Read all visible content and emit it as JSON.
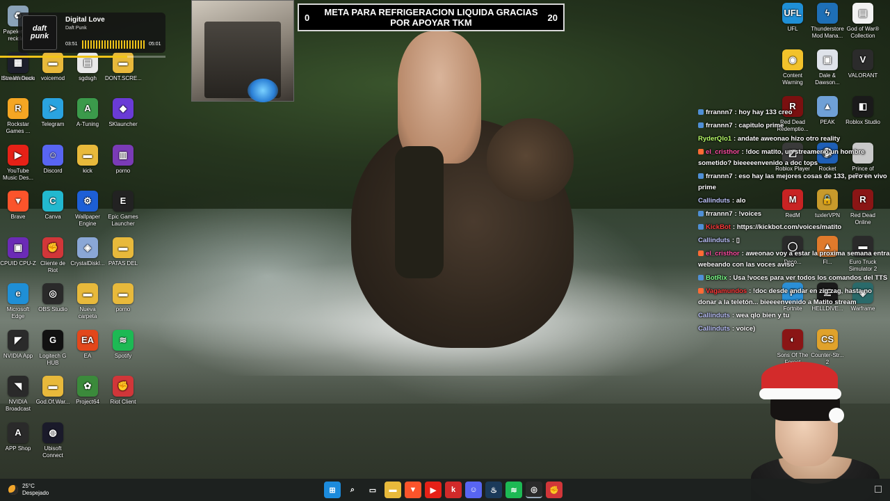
{
  "stream_goal": {
    "left_value": "0",
    "text": "META PARA REFRIGERACION LIQUIDA GRACIAS POR APOYAR TKM",
    "right_value": "20"
  },
  "music_widget": {
    "album_text": "daft punk",
    "title": "Digital Love",
    "artist": "Daft Punk",
    "elapsed": "03:51",
    "duration": "05:01",
    "progress": 0.77
  },
  "desktop_left": [
    {
      "name": "papelera",
      "label": "Papelera de reciclaje",
      "icon": "recycle-bin-icon",
      "color": "#8aa2b8",
      "glyph": "♻"
    },
    {
      "name": "iriun-webcam",
      "label": "Iriun Webcam",
      "icon": "webcam-icon",
      "color": "#2b6fd6",
      "glyph": "◉"
    },
    {
      "name": "stream-deck",
      "label": "Stream Deck",
      "icon": "stream-deck-icon",
      "color": "#1d1f2b",
      "glyph": "▦"
    },
    {
      "name": "voicemod",
      "label": "voicemod",
      "icon": "folder-icon",
      "color": "#e8b93b",
      "glyph": "▬"
    },
    {
      "name": "sgdsgh",
      "label": "sgdsgh",
      "icon": "document-icon",
      "color": "#e9e9e9",
      "glyph": "▤"
    },
    {
      "name": "dontscre",
      "label": "DONT.SCRE...",
      "icon": "folder-icon",
      "color": "#e8b93b",
      "glyph": "▬"
    },
    {
      "name": "rockstar",
      "label": "Rockstar Games ...",
      "icon": "rockstar-icon",
      "color": "#f5a623",
      "glyph": "R"
    },
    {
      "name": "telegram",
      "label": "Telegram",
      "icon": "telegram-icon",
      "color": "#2aa3e0",
      "glyph": "➤"
    },
    {
      "name": "a-tuning",
      "label": "A-Tuning",
      "icon": "a-tuning-icon",
      "color": "#3b9a4b",
      "glyph": "A"
    },
    {
      "name": "sklauncher",
      "label": "SKlauncher",
      "icon": "sklauncher-icon",
      "color": "#6a3bd6",
      "glyph": "◆"
    },
    {
      "name": "youtube-music",
      "label": "YouTube Music Des...",
      "icon": "youtube-music-icon",
      "color": "#e62117",
      "glyph": "▶"
    },
    {
      "name": "discord",
      "label": "Discord",
      "icon": "discord-icon",
      "color": "#5865f2",
      "glyph": "☺"
    },
    {
      "name": "kick",
      "label": "kick",
      "icon": "folder-icon",
      "color": "#e8b93b",
      "glyph": "▬"
    },
    {
      "name": "porno",
      "label": "porno",
      "icon": "winrar-icon",
      "color": "#7a3bb6",
      "glyph": "▥"
    },
    {
      "name": "brave",
      "label": "Brave",
      "icon": "brave-icon",
      "color": "#fb542b",
      "glyph": "▼"
    },
    {
      "name": "canva",
      "label": "Canva",
      "icon": "canva-icon",
      "color": "#22b8cf",
      "glyph": "C"
    },
    {
      "name": "wallpaper-engine",
      "label": "Wallpaper Engine",
      "icon": "wallpaper-engine-icon",
      "color": "#1d5fd6",
      "glyph": "⚙"
    },
    {
      "name": "epic-games",
      "label": "Epic Games Launcher",
      "icon": "epic-games-icon",
      "color": "#222222",
      "glyph": "E"
    },
    {
      "name": "cpuid",
      "label": "CPUID CPU-Z",
      "icon": "cpuz-icon",
      "color": "#6b2bb6",
      "glyph": "▣"
    },
    {
      "name": "riot-client",
      "label": "Cliente de Riot",
      "icon": "riot-icon",
      "color": "#d13639",
      "glyph": "✊"
    },
    {
      "name": "crystaldisk",
      "label": "CrystalDiskI...",
      "icon": "crystaldisk-icon",
      "color": "#8aa7d6",
      "glyph": "◈"
    },
    {
      "name": "patas-del",
      "label": "PATAS DEL",
      "icon": "folder-icon",
      "color": "#e8b93b",
      "glyph": "▬"
    },
    {
      "name": "edge",
      "label": "Microsoft Edge",
      "icon": "edge-icon",
      "color": "#1f8fd6",
      "glyph": "e"
    },
    {
      "name": "obs",
      "label": "OBS Studio",
      "icon": "obs-icon",
      "color": "#2a2a2a",
      "glyph": "◎"
    },
    {
      "name": "nueva-carpeta",
      "label": "Nueva carpeta",
      "icon": "folder-icon",
      "color": "#e8b93b",
      "glyph": "▬"
    },
    {
      "name": "porno-2",
      "label": "porno",
      "icon": "folder-icon",
      "color": "#e8b93b",
      "glyph": "▬"
    },
    {
      "name": "nvidia-app",
      "label": "NVIDIA App",
      "icon": "nvidia-icon",
      "color": "#2a2a2a",
      "glyph": "◤"
    },
    {
      "name": "logitech",
      "label": "Logitech G HUB",
      "icon": "logitech-icon",
      "color": "#111111",
      "glyph": "G"
    },
    {
      "name": "ea",
      "label": "EA",
      "icon": "ea-icon",
      "color": "#e3471b",
      "glyph": "EA"
    },
    {
      "name": "spotify",
      "label": "Spotify",
      "icon": "spotify-icon",
      "color": "#1db954",
      "glyph": "≋"
    },
    {
      "name": "nvidia-broadcast",
      "label": "NVIDIA Broadcast",
      "icon": "nvidia-broadcast-icon",
      "color": "#2a2a2a",
      "glyph": "◥"
    },
    {
      "name": "god-of-war-folder",
      "label": "God.Of.War...",
      "icon": "folder-icon",
      "color": "#e8b93b",
      "glyph": "▬"
    },
    {
      "name": "project64",
      "label": "Project64",
      "icon": "project64-icon",
      "color": "#3b8a3b",
      "glyph": "✿"
    },
    {
      "name": "riot-client-2",
      "label": "Riot Client",
      "icon": "riot-icon",
      "color": "#d13639",
      "glyph": "✊"
    },
    {
      "name": "app-shop",
      "label": "APP Shop",
      "icon": "app-shop-icon",
      "color": "#2a2a2a",
      "glyph": "A"
    },
    {
      "name": "ubisoft",
      "label": "Ubisoft Connect",
      "icon": "ubisoft-icon",
      "color": "#1a1a2a",
      "glyph": "◍"
    }
  ],
  "desktop_right": [
    {
      "name": "ufl",
      "label": "UFL",
      "icon": "ufl-icon",
      "color": "#1f8fd6",
      "glyph": "UFL"
    },
    {
      "name": "thunderstore",
      "label": "Thunderstore Mod Mana...",
      "icon": "thunderstore-icon",
      "color": "#1e6fb6",
      "glyph": "ϟ"
    },
    {
      "name": "gow-collection",
      "label": "God of War® Collection",
      "icon": "document-icon",
      "color": "#f2f2f2",
      "glyph": "▤"
    },
    {
      "name": "content-warning",
      "label": "Content Warning",
      "icon": "content-warning-icon",
      "color": "#f2c22b",
      "glyph": "◉"
    },
    {
      "name": "dale-dawson",
      "label": "Dale & Dawson...",
      "icon": "printer-icon",
      "color": "#dfe3ea",
      "glyph": "▣"
    },
    {
      "name": "valorant",
      "label": "VALORANT",
      "icon": "valorant-icon",
      "color": "#2b2b2b",
      "glyph": "V"
    },
    {
      "name": "red-dead-r",
      "label": "Red Dead Redemptio...",
      "icon": "red-dead-icon",
      "color": "#7a1010",
      "glyph": "R"
    },
    {
      "name": "peak",
      "label": "PEAK",
      "icon": "peak-icon",
      "color": "#6fa0d6",
      "glyph": "▲"
    },
    {
      "name": "roblox-studio",
      "label": "Roblox Studio",
      "icon": "roblox-icon",
      "color": "#1a1a1a",
      "glyph": "◧"
    },
    {
      "name": "roblox-player",
      "label": "Roblox Player",
      "icon": "roblox-player-icon",
      "color": "#3a3a3a",
      "glyph": "◩"
    },
    {
      "name": "rocket",
      "label": "Rocket",
      "icon": "rocket-icon",
      "color": "#1e5fb6",
      "glyph": "⚽"
    },
    {
      "name": "prince-of-persia",
      "label": "Prince of Persia",
      "icon": "prince-icon",
      "color": "#c9c9c9",
      "glyph": "◔"
    },
    {
      "name": "redm",
      "label": "RedM",
      "icon": "redm-icon",
      "color": "#c82323",
      "glyph": "M"
    },
    {
      "name": "tuxler",
      "label": "tuxlerVPN",
      "icon": "tuxler-icon",
      "color": "#c89a2b",
      "glyph": "🔒"
    },
    {
      "name": "red-dead-online",
      "label": "Red Dead Online",
      "icon": "red-dead-online-icon",
      "color": "#8a1515",
      "glyph": "R"
    },
    {
      "name": "decor",
      "label": "Deco...",
      "icon": "decor-icon",
      "color": "#2a2a2a",
      "glyph": "◯"
    },
    {
      "name": "fl",
      "label": "Fl...",
      "icon": "fl-icon",
      "color": "#e07a2b",
      "glyph": "▲"
    },
    {
      "name": "euro-truck",
      "label": "Euro Truck Simulator 2",
      "icon": "euro-truck-icon",
      "color": "#2a2a2a",
      "glyph": "▬"
    },
    {
      "name": "fortnite",
      "label": "Fortnite",
      "icon": "fortnite-icon",
      "color": "#2b8fd6",
      "glyph": "F"
    },
    {
      "name": "helldivers",
      "label": "HELLDIVE...",
      "icon": "helldivers-icon",
      "color": "#1a1a1a",
      "glyph": "☰"
    },
    {
      "name": "warframe",
      "label": "Warframe",
      "icon": "warframe-icon",
      "color": "#2a6a6a",
      "glyph": "◈"
    },
    {
      "name": "sons-of-forest",
      "label": "Sons Of The Forest",
      "icon": "sons-forest-icon",
      "color": "#8a1515",
      "glyph": "◐"
    },
    {
      "name": "counter-strike",
      "label": "Counter-Str... 2",
      "icon": "counter-strike-icon",
      "color": "#e0a22b",
      "glyph": "CS"
    }
  ],
  "chat": [
    {
      "user": "frrannn7",
      "text": ": hoy hay 133 creo",
      "color": "#ffffff",
      "badge": "#4f8fd6"
    },
    {
      "user": "frrannn7",
      "text": ": capitulo prime",
      "color": "#ffffff",
      "badge": "#4f8fd6"
    },
    {
      "user": "RyderQlo1",
      "text": ": andate aweonao hizo otro reality",
      "color": "#b9ff6a",
      "badge": ""
    },
    {
      "user": "el_cristhor",
      "text": ": !doc matito, un streamer o un hombre sometido? bieeeeenvenido a doc tops",
      "color": "#ff4fa3",
      "badge": "#ff6b35"
    },
    {
      "user": "frrannn7",
      "text": ": eso hay las mejores cosas de 133, pero en vivo prime",
      "color": "#ffffff",
      "badge": "#4f8fd6"
    },
    {
      "user": "Callinduts",
      "text": ": alo",
      "color": "#c0c7ff",
      "badge": ""
    },
    {
      "user": "frrannn7",
      "text": ": !voices",
      "color": "#ffffff",
      "badge": "#4f8fd6"
    },
    {
      "user": "KickBot",
      "text": ": https://kickbot.com/voices/matito",
      "color": "#ff3b3b",
      "badge": "#4f8fd6"
    },
    {
      "user": "Callinduts",
      "text": ": ▯",
      "color": "#c0c7ff",
      "badge": ""
    },
    {
      "user": "el_cristhor",
      "text": ": aweonao voy a estar la proxima semana entra webeando con las voces aviso",
      "color": "#ff4fa3",
      "badge": "#ff6b35"
    },
    {
      "user": "BotRix",
      "text": ": Usa !voces para ver todos los comandos del TTS",
      "color": "#7cff8a",
      "badge": "#4f8fd6"
    },
    {
      "user": "Vagamundos",
      "text": ": !doc desde andar en zig zag, hasta no donar a la teletón... bieeeenvenido a Matito stream",
      "color": "#ff3b3b",
      "badge": "#ff6b35"
    },
    {
      "user": "Callinduts",
      "text": ": wea qlo bien y tu",
      "color": "#c0c7ff",
      "badge": ""
    },
    {
      "user": "Callinduts",
      "text": ": voice)",
      "color": "#c0c7ff",
      "badge": ""
    }
  ],
  "taskbar": {
    "weather_temp": "25°C",
    "weather_desc": "Despejado",
    "apps": [
      {
        "name": "start-button",
        "icon": "windows-icon",
        "color": "#1c8bdc",
        "glyph": "⊞",
        "active": false
      },
      {
        "name": "search-button",
        "icon": "search-icon",
        "color": "transparent",
        "glyph": "⌕",
        "active": false
      },
      {
        "name": "task-view-button",
        "icon": "task-view-icon",
        "color": "transparent",
        "glyph": "▭",
        "active": false
      },
      {
        "name": "file-explorer-button",
        "icon": "folder-icon",
        "color": "#e8b93b",
        "glyph": "▬",
        "active": false
      },
      {
        "name": "brave-button",
        "icon": "brave-icon",
        "color": "#fb542b",
        "glyph": "▼",
        "active": false
      },
      {
        "name": "youtube-music-button",
        "icon": "youtube-music-icon",
        "color": "#e62117",
        "glyph": "▶",
        "active": false
      },
      {
        "name": "kick-button",
        "icon": "kick-icon",
        "color": "#d12a2a",
        "glyph": "k",
        "active": false
      },
      {
        "name": "discord-button",
        "icon": "discord-icon",
        "color": "#5865f2",
        "glyph": "☺",
        "active": false
      },
      {
        "name": "steam-button",
        "icon": "steam-icon",
        "color": "#1b3a5a",
        "glyph": "♨",
        "active": false
      },
      {
        "name": "spotify-button",
        "icon": "spotify-icon",
        "color": "#1db954",
        "glyph": "≋",
        "active": false
      },
      {
        "name": "obs-button",
        "icon": "obs-icon",
        "color": "#2a2a2a",
        "glyph": "◎",
        "active": true
      },
      {
        "name": "riot-button",
        "icon": "riot-icon",
        "color": "#d13639",
        "glyph": "✊",
        "active": false
      }
    ]
  }
}
